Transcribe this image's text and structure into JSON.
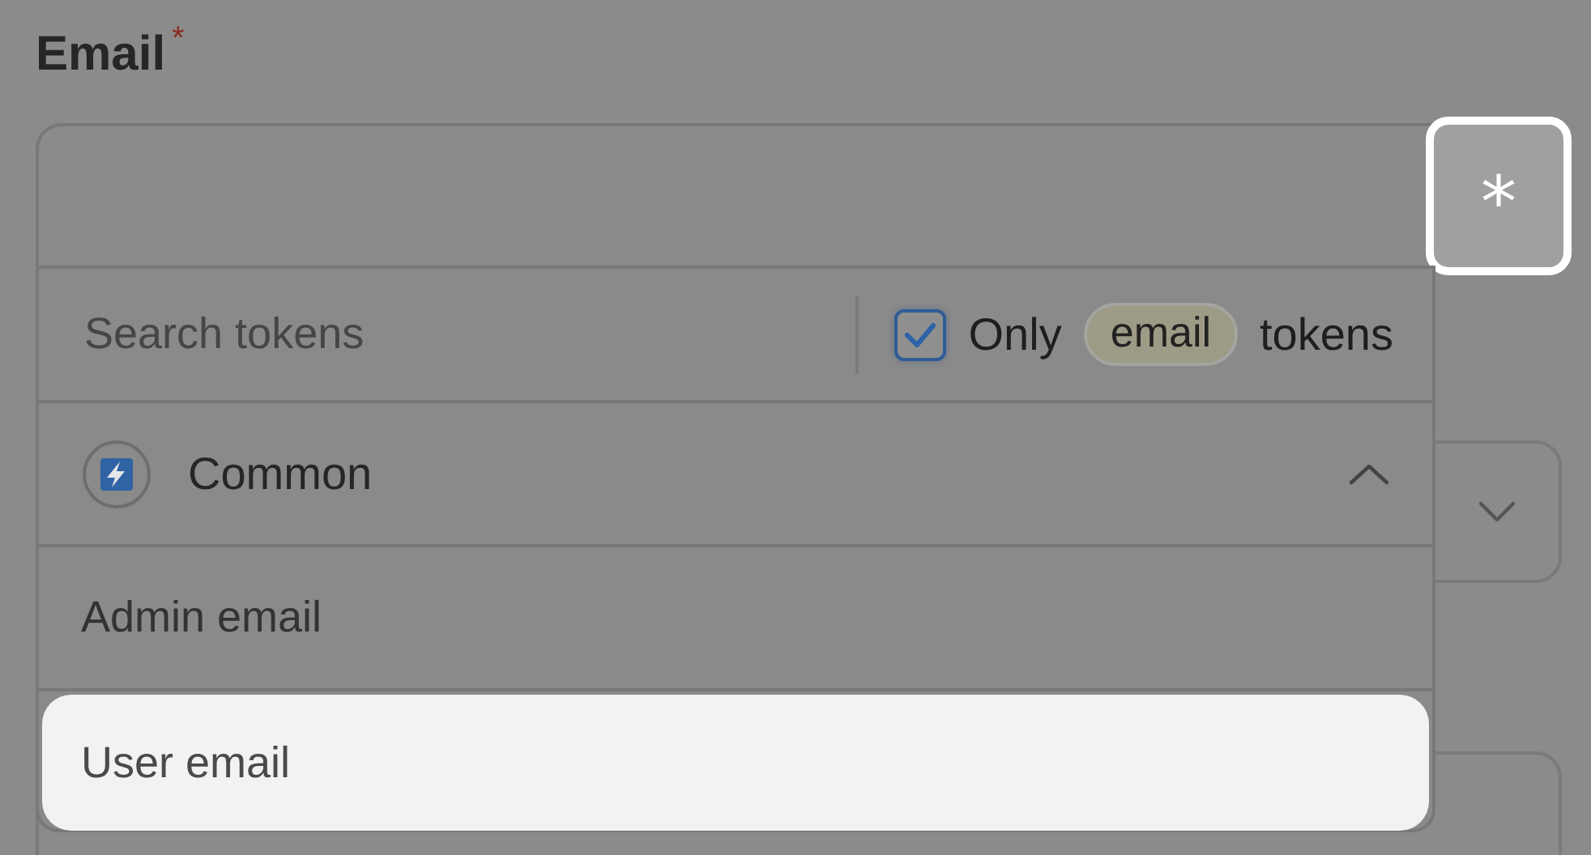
{
  "field": {
    "label": "Email",
    "required_mark": "*",
    "trigger": "*"
  },
  "dropdown": {
    "search": {
      "placeholder": "Search tokens"
    },
    "filter": {
      "checked": true,
      "prefix": "Only",
      "tag": "email",
      "suffix": "tokens"
    },
    "group": {
      "label": "Common",
      "expanded": true
    },
    "items": [
      {
        "label": "Admin email",
        "selected": false
      },
      {
        "label": "User email",
        "selected": true
      }
    ]
  }
}
